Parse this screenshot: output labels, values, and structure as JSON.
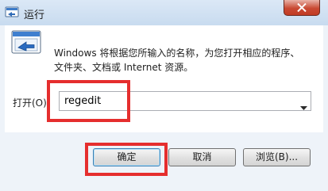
{
  "window": {
    "title": "运行"
  },
  "dialog": {
    "description_line1": "Windows 将根据您所输入的名称，为您打开相应的程序、",
    "description_line2": "文件夹、文档或 Internet 资源。"
  },
  "open_field": {
    "label": "打开(O):",
    "value": "regedit"
  },
  "buttons": {
    "ok": "确定",
    "cancel": "取消",
    "browse": "浏览(B)..."
  },
  "colors": {
    "highlight": "#e52e2e",
    "close_button": "#c94a33"
  },
  "icons": {
    "title": "run-icon",
    "main": "run-program-icon",
    "close": "close-icon",
    "dropdown": "chevron-down-icon"
  }
}
